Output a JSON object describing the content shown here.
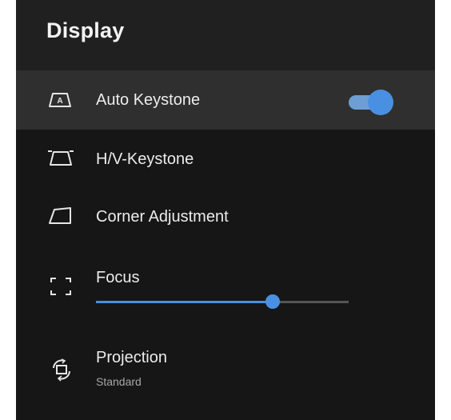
{
  "header": {
    "title": "Display"
  },
  "items": [
    {
      "label": "Auto Keystone",
      "icon": "auto-keystone-icon",
      "toggle_on": true,
      "selected": true
    },
    {
      "label": "H/V-Keystone",
      "icon": "hv-keystone-icon"
    },
    {
      "label": "Corner Adjustment",
      "icon": "corner-adjustment-icon"
    },
    {
      "label": "Focus",
      "icon": "focus-icon",
      "slider_fraction": 0.7
    },
    {
      "label": "Projection",
      "icon": "projection-icon",
      "value": "Standard"
    }
  ],
  "colors": {
    "accent": "#4a90e2",
    "background": "#161616",
    "header": "#202020",
    "selected_row": "#2f2f2f"
  }
}
